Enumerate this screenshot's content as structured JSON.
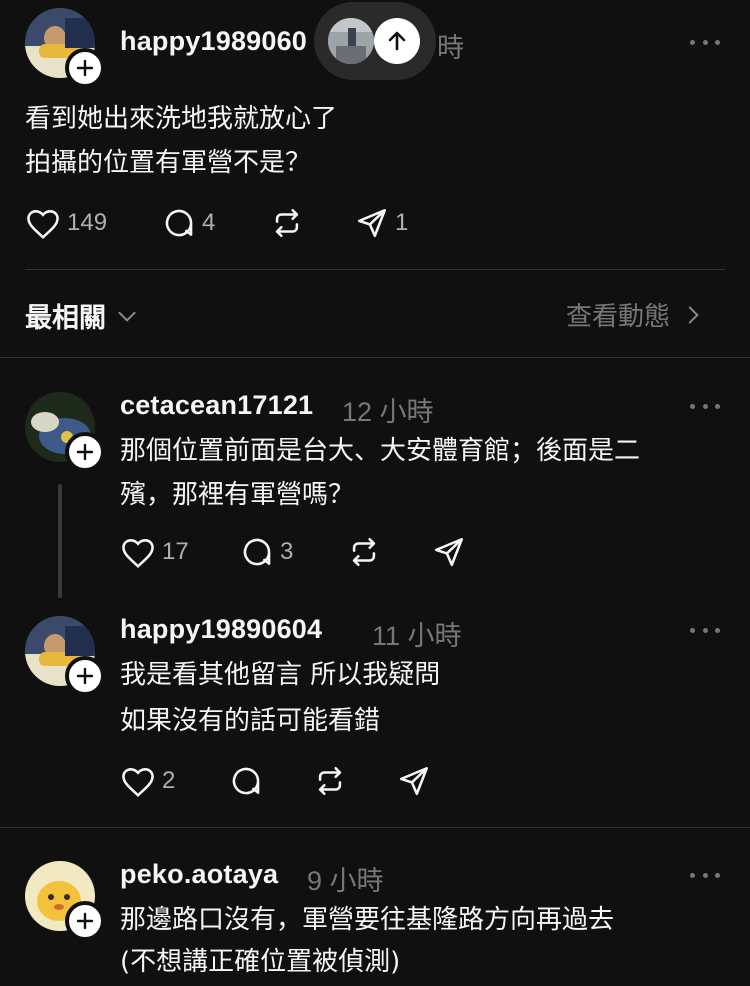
{
  "main_post": {
    "username": "happy1989060",
    "time": "時",
    "lines": [
      "看到她出來洗地我就放心了",
      "拍攝的位置有軍營不是？"
    ],
    "likes": "149",
    "replies": "4",
    "shares": "1"
  },
  "sort_bar": {
    "label": "最相關",
    "activity_link": "查看動態"
  },
  "comments": [
    {
      "username": "cetacean17121",
      "time": "12 小時",
      "lines": [
        "那個位置前面是台大、大安體育館；後面是二",
        "殯，那裡有軍營嗎？"
      ],
      "likes": "17",
      "replies": "3"
    },
    {
      "username": "happy19890604",
      "time": "11 小時",
      "lines": [
        "我是看其他留言 所以我疑問",
        "如果沒有的話可能看錯"
      ],
      "likes": "2",
      "replies": ""
    },
    {
      "username": "peko.aotaya",
      "time": "9 小時",
      "lines": [
        "那邊路口沒有，軍營要往基隆路方向再過去",
        "(不想講正確位置被偵測)"
      ]
    }
  ],
  "colors": {
    "background": "#101010",
    "primary_text": "#f3f5f7",
    "secondary_text": "#777777",
    "divider": "#323232"
  }
}
